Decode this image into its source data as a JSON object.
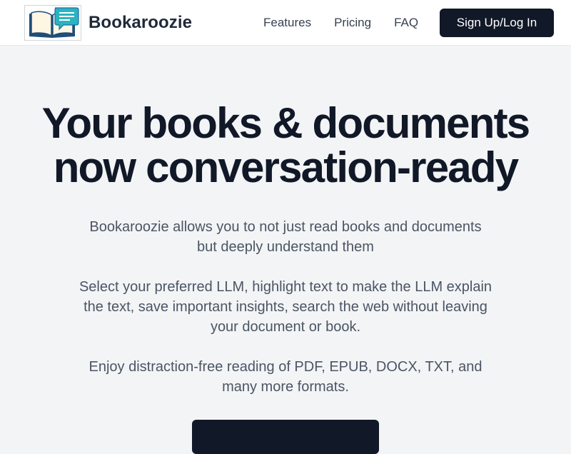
{
  "header": {
    "brand_name": "Bookaroozie",
    "logo_icon": "book-chat-logo-icon",
    "nav": [
      {
        "label": "Features"
      },
      {
        "label": "Pricing"
      },
      {
        "label": "FAQ"
      }
    ],
    "signup_label": "Sign Up/Log In"
  },
  "hero": {
    "title_line1": "Your books & documents",
    "title_line2": "now conversation-ready",
    "paragraph1": "Bookaroozie allows you to not just read books and documents but deeply understand them",
    "paragraph2": "Select your preferred LLM, highlight text to make the LLM explain the text, save important insights, search the web without leaving your document or book.",
    "paragraph3": "Enjoy distraction-free reading of PDF, EPUB, DOCX, TXT, and many more formats.",
    "cta_label": ""
  },
  "colors": {
    "primary_dark": "#111827",
    "background": "#f3f4f6",
    "logo_blue": "#1f6fa8",
    "logo_teal": "#2bb3c0"
  }
}
